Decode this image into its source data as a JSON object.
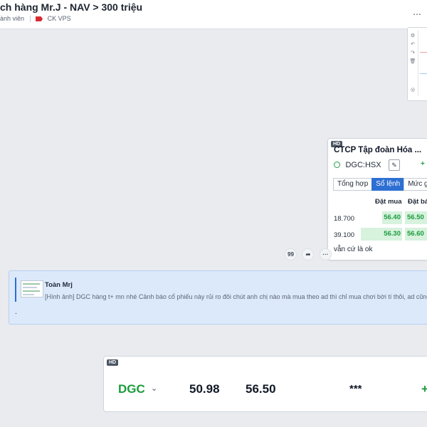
{
  "header": {
    "title": "ch hàng Mr.J - NAV > 300 triệu",
    "members": "ành viên",
    "tag": "CK VPS"
  },
  "preview_card": {
    "icons": [
      "gear-icon",
      "undo-icon",
      "redo-icon",
      "trash-icon",
      "camera-icon"
    ]
  },
  "stock_card": {
    "badge": "HD",
    "name": "CTCP Tập đoàn Hóa ...",
    "code": "DGC:HSX",
    "change": "+",
    "tabs": [
      "Tổng hợp",
      "Sổ lệnh",
      "Mức g"
    ],
    "active_tab": "Sổ lệnh",
    "header_buy": "Đặt mua",
    "header_sell": "Đặt bá",
    "rows": [
      {
        "qty": "18.700",
        "bid": "56.40",
        "ask": "56.50"
      },
      {
        "qty": "39.100",
        "bid": "56.30",
        "ask": "56.60"
      }
    ],
    "caption": "vẫn cứ là ok"
  },
  "actions": {
    "quote": "99",
    "forward": "➦",
    "more": "···"
  },
  "quote": {
    "author": "Toàn Mrj",
    "text": "[Hình ảnh] DGC hàng t+ mn nhé Cảnh báo cổ phiếu này rủi ro đôi chút anh chị nào mà mua theo ad thì chỉ mua chơi bời tí thôi, ad cũng c",
    "reply": "."
  },
  "ticker": {
    "badge": "HD",
    "symbol": "DGC",
    "value1": "50.98",
    "value2": "56.50",
    "masked": "***",
    "plus": "+"
  },
  "colors": {
    "accent": "#2d6fd2",
    "up_green": "#1a9c3d",
    "quote_bg": "#dce9fb",
    "tag_red": "#d6282f"
  }
}
